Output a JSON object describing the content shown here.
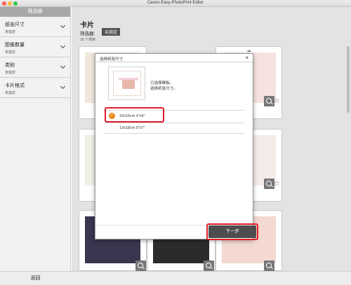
{
  "window": {
    "title": "Canon Easy-PhotoPrint Editor"
  },
  "sidebar": {
    "header": "筛选器",
    "filters": [
      {
        "title": "纸张尺寸",
        "value": "未指定"
      },
      {
        "title": "图像数量",
        "value": "未指定"
      },
      {
        "title": "类别",
        "value": "未指定"
      },
      {
        "title": "卡片格式",
        "value": "未指定"
      }
    ],
    "back_label": "返回"
  },
  "main": {
    "title": "卡片",
    "filter_label": "筛选器:",
    "filter_badge": "未指定",
    "result_count": "18 个项目"
  },
  "dialog": {
    "title": "选择纸张尺寸",
    "close": "×",
    "message": "已选择模板。\n选择纸张尺寸。",
    "sizes": [
      {
        "label": "10x15cm 4\"x6\"",
        "selected": true
      },
      {
        "label": "13x18cm 5\"x7\"",
        "selected": false
      }
    ],
    "next_label": "下一步"
  },
  "colors": {
    "accent": "#e98a1b",
    "highlight": "#e21c27",
    "button": "#4d4d4d"
  },
  "icons": [
    "chevron-down-icon",
    "zoom-icon",
    "star-icon",
    "cloud-icon",
    "check-icon",
    "close-icon"
  ]
}
